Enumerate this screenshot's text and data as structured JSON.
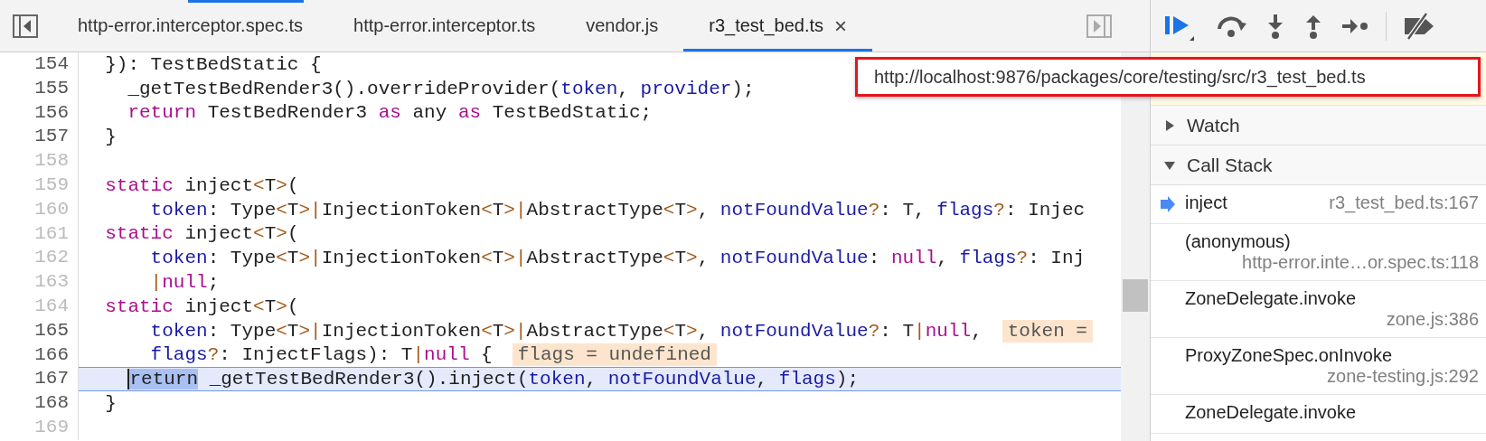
{
  "tabs": [
    {
      "label": "http-error.interceptor.spec.ts",
      "selected": false,
      "closable": false
    },
    {
      "label": "http-error.interceptor.ts",
      "selected": false,
      "closable": false
    },
    {
      "label": "vendor.js",
      "selected": false,
      "closable": false
    },
    {
      "label": "r3_test_bed.ts",
      "selected": true,
      "closable": true
    }
  ],
  "tab_close": "×",
  "editor": {
    "lines": [
      {
        "number": "154",
        "executable": true,
        "current": false,
        "tokens": [
          {
            "kind": "plain",
            "text": "  }): TestBedStatic {"
          }
        ]
      },
      {
        "number": "155",
        "executable": true,
        "current": false,
        "tokens": [
          {
            "kind": "plain",
            "text": "    _getTestBedRender3().overrideProvider("
          },
          {
            "kind": "variable",
            "text": "token"
          },
          {
            "kind": "plain",
            "text": ", "
          },
          {
            "kind": "variable",
            "text": "provider"
          },
          {
            "kind": "plain",
            "text": ");"
          }
        ]
      },
      {
        "number": "156",
        "executable": true,
        "current": false,
        "tokens": [
          {
            "kind": "keyword",
            "text": "    return"
          },
          {
            "kind": "plain",
            "text": " TestBedRender3 "
          },
          {
            "kind": "keyword",
            "text": "as"
          },
          {
            "kind": "plain",
            "text": " any "
          },
          {
            "kind": "keyword",
            "text": "as"
          },
          {
            "kind": "plain",
            "text": " TestBedStatic;"
          }
        ]
      },
      {
        "number": "157",
        "executable": true,
        "current": false,
        "tokens": [
          {
            "kind": "plain",
            "text": "  }"
          }
        ]
      },
      {
        "number": "158",
        "executable": false,
        "current": false
      },
      {
        "number": "159",
        "executable": false,
        "current": false,
        "tokens": [
          {
            "kind": "keyword",
            "text": "  static"
          },
          {
            "kind": "plain",
            "text": " inject"
          },
          {
            "kind": "operator",
            "text": "<"
          },
          {
            "kind": "plain",
            "text": "T"
          },
          {
            "kind": "operator",
            "text": ">"
          },
          {
            "kind": "plain",
            "text": "("
          }
        ]
      },
      {
        "number": "160",
        "executable": false,
        "current": false,
        "tokens": [
          {
            "kind": "variable",
            "text": "      token"
          },
          {
            "kind": "plain",
            "text": ": Type"
          },
          {
            "kind": "operator",
            "text": "<"
          },
          {
            "kind": "plain",
            "text": "T"
          },
          {
            "kind": "operator",
            "text": ">|"
          },
          {
            "kind": "plain",
            "text": "InjectionToken"
          },
          {
            "kind": "operator",
            "text": "<"
          },
          {
            "kind": "plain",
            "text": "T"
          },
          {
            "kind": "operator",
            "text": ">|"
          },
          {
            "kind": "plain",
            "text": "AbstractType"
          },
          {
            "kind": "operator",
            "text": "<"
          },
          {
            "kind": "plain",
            "text": "T"
          },
          {
            "kind": "operator",
            "text": ">"
          },
          {
            "kind": "plain",
            "text": ", "
          },
          {
            "kind": "variable",
            "text": "notFoundValue"
          },
          {
            "kind": "operator",
            "text": "?"
          },
          {
            "kind": "plain",
            "text": ": T, "
          },
          {
            "kind": "variable",
            "text": "flags"
          },
          {
            "kind": "operator",
            "text": "?"
          },
          {
            "kind": "plain",
            "text": ": Injec"
          }
        ]
      },
      {
        "number": "161",
        "executable": false,
        "current": false,
        "tokens": [
          {
            "kind": "keyword",
            "text": "  static"
          },
          {
            "kind": "plain",
            "text": " inject"
          },
          {
            "kind": "operator",
            "text": "<"
          },
          {
            "kind": "plain",
            "text": "T"
          },
          {
            "kind": "operator",
            "text": ">"
          },
          {
            "kind": "plain",
            "text": "("
          }
        ]
      },
      {
        "number": "162",
        "executable": false,
        "current": false,
        "tokens": [
          {
            "kind": "variable",
            "text": "      token"
          },
          {
            "kind": "plain",
            "text": ": Type"
          },
          {
            "kind": "operator",
            "text": "<"
          },
          {
            "kind": "plain",
            "text": "T"
          },
          {
            "kind": "operator",
            "text": ">|"
          },
          {
            "kind": "plain",
            "text": "InjectionToken"
          },
          {
            "kind": "operator",
            "text": "<"
          },
          {
            "kind": "plain",
            "text": "T"
          },
          {
            "kind": "operator",
            "text": ">|"
          },
          {
            "kind": "plain",
            "text": "AbstractType"
          },
          {
            "kind": "operator",
            "text": "<"
          },
          {
            "kind": "plain",
            "text": "T"
          },
          {
            "kind": "operator",
            "text": ">"
          },
          {
            "kind": "plain",
            "text": ", "
          },
          {
            "kind": "variable",
            "text": "notFoundValue"
          },
          {
            "kind": "plain",
            "text": ": "
          },
          {
            "kind": "keyword",
            "text": "null"
          },
          {
            "kind": "plain",
            "text": ", "
          },
          {
            "kind": "variable",
            "text": "flags"
          },
          {
            "kind": "operator",
            "text": "?"
          },
          {
            "kind": "plain",
            "text": ": Inj"
          }
        ]
      },
      {
        "number": "163",
        "executable": false,
        "current": false,
        "tokens": [
          {
            "kind": "operator",
            "text": "      |"
          },
          {
            "kind": "keyword",
            "text": "null"
          },
          {
            "kind": "plain",
            "text": ";"
          }
        ]
      },
      {
        "number": "164",
        "executable": false,
        "current": false,
        "tokens": [
          {
            "kind": "keyword",
            "text": "  static"
          },
          {
            "kind": "plain",
            "text": " inject"
          },
          {
            "kind": "operator",
            "text": "<"
          },
          {
            "kind": "plain",
            "text": "T"
          },
          {
            "kind": "operator",
            "text": ">"
          },
          {
            "kind": "plain",
            "text": "("
          }
        ]
      },
      {
        "number": "165",
        "executable": true,
        "current": false,
        "tokens": [
          {
            "kind": "variable",
            "text": "      token"
          },
          {
            "kind": "plain",
            "text": ": Type"
          },
          {
            "kind": "operator",
            "text": "<"
          },
          {
            "kind": "plain",
            "text": "T"
          },
          {
            "kind": "operator",
            "text": ">|"
          },
          {
            "kind": "plain",
            "text": "InjectionToken"
          },
          {
            "kind": "operator",
            "text": "<"
          },
          {
            "kind": "plain",
            "text": "T"
          },
          {
            "kind": "operator",
            "text": ">|"
          },
          {
            "kind": "plain",
            "text": "AbstractType"
          },
          {
            "kind": "operator",
            "text": "<"
          },
          {
            "kind": "plain",
            "text": "T"
          },
          {
            "kind": "operator",
            "text": ">"
          },
          {
            "kind": "plain",
            "text": ", "
          },
          {
            "kind": "variable",
            "text": "notFoundValue"
          },
          {
            "kind": "operator",
            "text": "?"
          },
          {
            "kind": "plain",
            "text": ": T"
          },
          {
            "kind": "operator",
            "text": "|"
          },
          {
            "kind": "keyword",
            "text": "null"
          },
          {
            "kind": "plain",
            "text": ","
          }
        ],
        "inline_value": "token ="
      },
      {
        "number": "166",
        "executable": true,
        "current": false,
        "tokens": [
          {
            "kind": "variable",
            "text": "      flags"
          },
          {
            "kind": "operator",
            "text": "?"
          },
          {
            "kind": "plain",
            "text": ": InjectFlags): T"
          },
          {
            "kind": "operator",
            "text": "|"
          },
          {
            "kind": "keyword",
            "text": "null"
          },
          {
            "kind": "plain",
            "text": " {"
          }
        ],
        "inline_value": "flags = undefined"
      },
      {
        "number": "167",
        "executable": true,
        "current": true,
        "tokens": [
          {
            "kind": "execution-point",
            "text": "    return"
          },
          {
            "kind": "plain",
            "text": " _getTestBedRender3().inject("
          },
          {
            "kind": "variable",
            "text": "token"
          },
          {
            "kind": "plain",
            "text": ", "
          },
          {
            "kind": "variable",
            "text": "notFoundValue"
          },
          {
            "kind": "plain",
            "text": ", "
          },
          {
            "kind": "variable",
            "text": "flags"
          },
          {
            "kind": "plain",
            "text": ");"
          }
        ]
      },
      {
        "number": "168",
        "executable": true,
        "current": false,
        "tokens": [
          {
            "kind": "plain",
            "text": "  }"
          }
        ]
      },
      {
        "number": "169",
        "executable": false,
        "current": false
      }
    ]
  },
  "tooltip": {
    "text": "http://localhost:9876/packages/core/testing/src/r3_test_bed.ts",
    "highlighted": true
  },
  "sidebar": {
    "sections": [
      {
        "title": "Watch",
        "expanded": false
      },
      {
        "title": "Call Stack",
        "expanded": true
      }
    ],
    "call_stack": [
      {
        "function": "inject",
        "location": "r3_test_bed.ts:167",
        "current": true
      },
      {
        "function": "(anonymous)",
        "location": "http-error.inte…or.spec.ts:118",
        "current": false
      },
      {
        "function": "ZoneDelegate.invoke",
        "location": "zone.js:386",
        "current": false
      },
      {
        "function": "ProxyZoneSpec.onInvoke",
        "location": "zone-testing.js:292",
        "current": false
      },
      {
        "function": "ZoneDelegate.invoke",
        "current": false
      }
    ]
  }
}
